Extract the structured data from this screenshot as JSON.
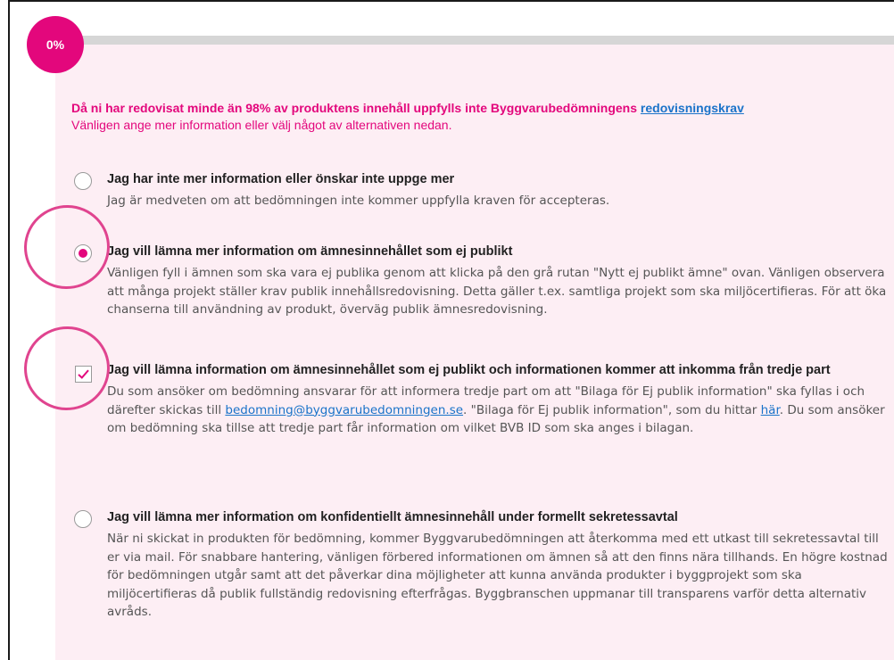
{
  "progress": {
    "label": "0%",
    "value_percent": 0,
    "color": "#e3077c"
  },
  "warning": {
    "line1_text": "Då ni har redovisat minde än 98% av produktens innehåll uppfylls inte Byggvarubedömningens",
    "line1_link": "redovisningskrav",
    "line2": "Vänligen ange mer information eller välj något av alternativen nedan."
  },
  "options": [
    {
      "type": "radio",
      "checked": false,
      "title": "Jag har inte mer information eller önskar inte uppge mer",
      "desc": "Jag är medveten om att bedömningen inte kommer uppfylla kraven för accepteras."
    },
    {
      "type": "radio",
      "checked": true,
      "title": "Jag vill lämna mer information om ämnesinnehållet som ej publikt",
      "desc": "Vänligen fyll i ämnen som ska vara ej publika genom att klicka på den grå rutan \"Nytt ej publikt ämne\" ovan. Vänligen observera att många projekt ställer krav publik innehållsredovisning. Detta gäller t.ex. samtliga projekt som ska miljöcertifieras. För att öka chanserna till användning av produkt, överväg publik ämnesredovisning."
    },
    {
      "type": "checkbox",
      "checked": true,
      "title": "Jag vill lämna information om ämnesinnehållet som ej publikt och informationen kommer att inkomma från tredje part",
      "desc_a": "Du som ansöker om bedömning ansvarar för att informera tredje part om att \"Bilaga för Ej publik information\" ska fyllas i och därefter skickas till",
      "email_link": "bedomning@byggvarubedomningen.se",
      "desc_b": ". \"Bilaga för Ej publik information\", som du hittar",
      "here_link": "här",
      "desc_c": ". Du som ansöker om bedömning ska tillse att tredje part får information om vilket BVB ID som ska anges i bilagan."
    },
    {
      "type": "radio",
      "checked": false,
      "title": "Jag vill lämna mer information om konfidentiellt ämnesinnehåll under formellt sekretessavtal",
      "desc": "När ni skickat in produkten för bedömning, kommer Byggvarubedömningen att återkomma med ett utkast till sekretessavtal till er via mail. För snabbare hantering, vänligen förbered informationen om ämnen så att den finns nära tillhands. En högre kostnad för bedömningen utgår samt att det påverkar dina möjligheter att kunna använda produkter i byggprojekt som ska miljöcertifieras då publik fullständig redovisning efterfrågas. Byggbranschen uppmanar till transparens varför detta alternativ avråds."
    }
  ],
  "colors": {
    "accent": "#e3077c",
    "panel_bg": "#fdeef4",
    "link": "#1a73c9",
    "annotation_ring": "#e0448f"
  }
}
